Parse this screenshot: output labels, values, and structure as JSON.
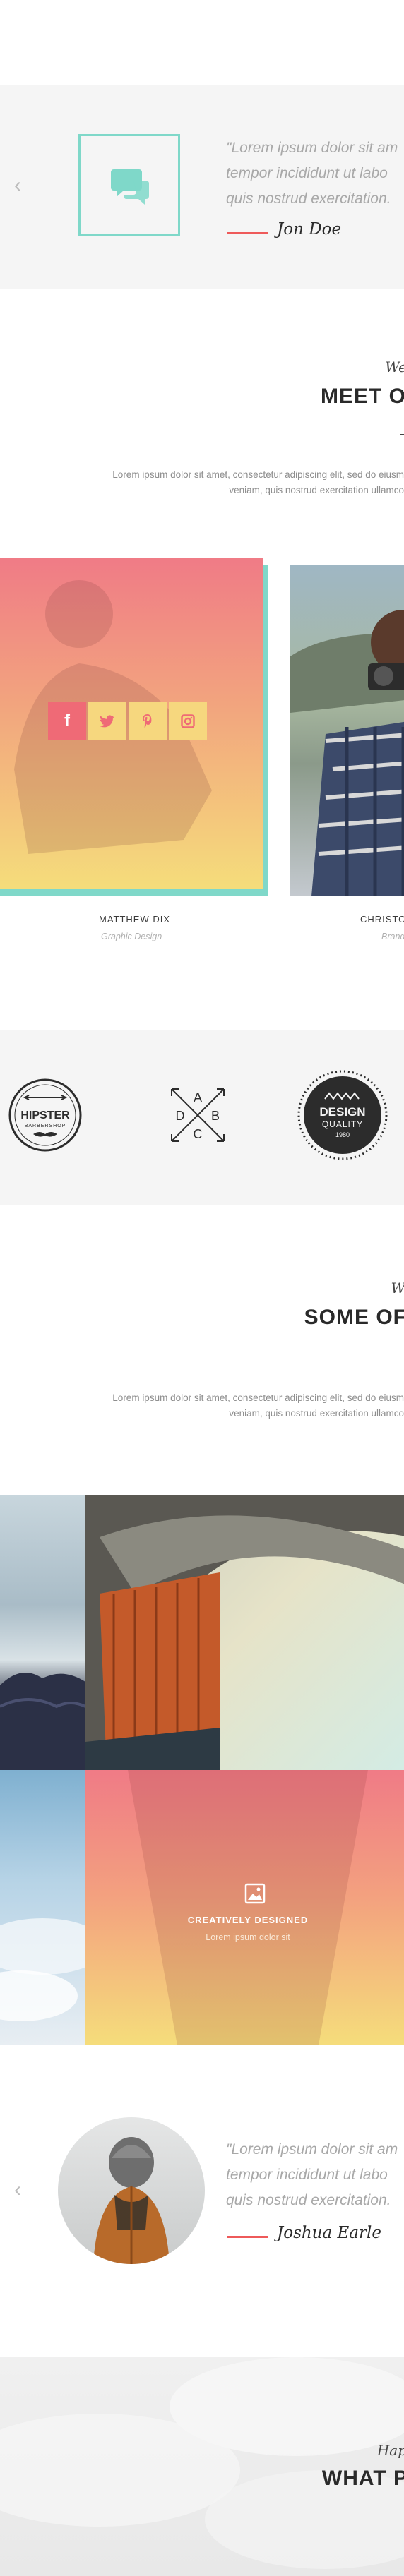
{
  "testimonial_top": {
    "quote_lines": [
      "\"Lorem ipsum dolor sit am",
      "tempor incididunt ut labo",
      "quis nostrud exercitation."
    ],
    "author": "Jon Doe",
    "prev_arrow": "‹"
  },
  "team": {
    "pretitle": "We",
    "title": "MEET O",
    "body_lines": [
      "Lorem ipsum dolor sit amet, consectetur adipiscing elit, sed do eiusm",
      "veniam, quis nostrud exercitation ullamco"
    ],
    "members": [
      {
        "name": "MATTHEW DIX",
        "role": "Graphic Design"
      },
      {
        "name": "CHRISTO",
        "role": "Brand"
      }
    ],
    "social": [
      {
        "icon": "facebook-icon",
        "label": "f"
      },
      {
        "icon": "twitter-icon",
        "label": "t"
      },
      {
        "icon": "pinterest-icon",
        "label": "p"
      },
      {
        "icon": "instagram-icon",
        "label": "ig"
      }
    ]
  },
  "clients": {
    "logos": [
      {
        "name": "hipster-barbershop-logo",
        "title": "HIPSTER",
        "subtitle": "BARBERSHOP"
      },
      {
        "name": "abcd-arrows-logo",
        "letters": [
          "A",
          "D",
          "B",
          "C"
        ]
      },
      {
        "name": "design-quality-badge",
        "title": "DESIGN",
        "subtitle": "QUALITY",
        "year": "1980"
      }
    ]
  },
  "works": {
    "pretitle": "W",
    "title": "SOME OF",
    "body_lines": [
      "Lorem ipsum dolor sit amet, consectetur adipiscing elit, sed do eiusm",
      "veniam, quis nostrud exercitation ullamco"
    ],
    "featured": {
      "title": "CREATIVELY DESIGNED",
      "subtitle": "Lorem ipsum dolor sit"
    }
  },
  "testimonial_bottom": {
    "quote_lines": [
      "\"Lorem ipsum dolor sit am",
      "tempor incididunt ut labo",
      "quis nostrud exercitation."
    ],
    "author": "Joshua Earle",
    "prev_arrow": "‹"
  },
  "pricing": {
    "pretitle": "Hap",
    "title": "WHAT P"
  },
  "colors": {
    "accent": "#ee5a5a",
    "teal": "#7fd8c9",
    "gradient_top": "#f07b86",
    "gradient_bottom": "#f5dd7b"
  }
}
